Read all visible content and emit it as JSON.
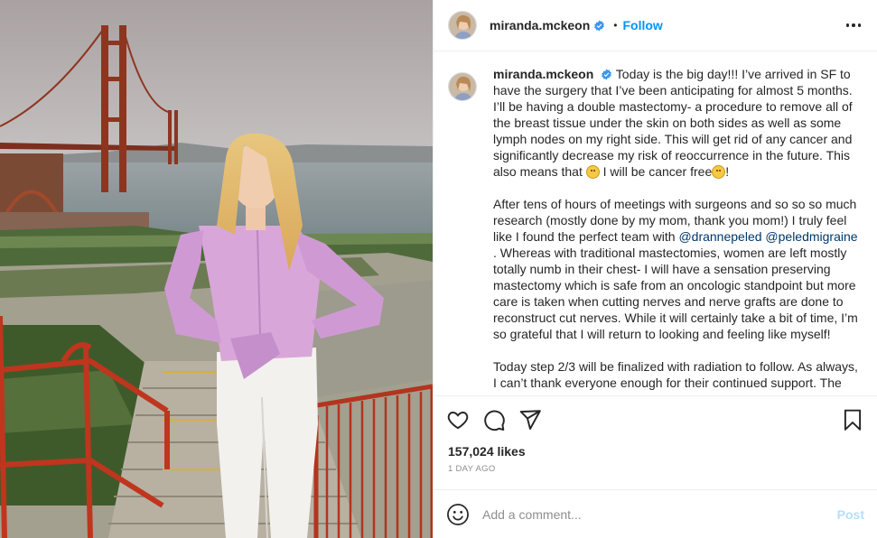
{
  "post": {
    "username": "miranda.mckeon",
    "verified": true,
    "separator": "•",
    "follow_label": "Follow",
    "more_icon": "more-options-icon",
    "image_alt": "Woman in pink shirt and white jeans standing on steps in front of the Golden Gate Bridge"
  },
  "caption": {
    "username": "miranda.mckeon",
    "p1_a": "Today is the big day!!! I’ve arrived in SF to have the surgery that I’ve been anticipating for almost 5 months. I’ll be having a double mastectomy- a procedure to remove all of the breast tissue under the skin on both sides as well as some lymph nodes on my right side. This will get rid of any cancer and significantly decrease my risk of reoccurrence in the future. This also means that",
    "p1_b": "I will be cancer free",
    "p1_c": "!",
    "p2_a": "After tens of hours of meetings with surgeons and so so so much research (mostly done by my mom, thank you mom!) I truly feel like I found the perfect team with",
    "mention1": "@drannepeled",
    "mention2": "@peledmigraine",
    "p2_b": ". Whereas with traditional mastectomies, women are left mostly totally numb in their chest- I will have a sensation preserving mastectomy which is safe from an oncologic standpoint but more care is taken when cutting nerves and nerve grafts are done to reconstruct cut nerves. While it will certainly take a bit of time, I’m so grateful that I will return to looking and feeling like myself!",
    "p3": "Today step 2/3 will be finalized with radiation to follow. As always, I can’t thank everyone enough for their continued support. The",
    "emoji_icon": "smiling-face-with-hearts-icon"
  },
  "actions": {
    "like_icon": "heart-icon",
    "comment_icon": "comment-icon",
    "share_icon": "share-icon",
    "save_icon": "bookmark-icon"
  },
  "likes": "157,024 likes",
  "time": "1 DAY AGO",
  "comment_box": {
    "placeholder": "Add a comment...",
    "value": "",
    "post_label": "Post",
    "emoji_icon": "smiley-icon"
  },
  "colors": {
    "accent": "#0095f6",
    "post_disabled": "#b2dffc",
    "mention": "#00376b",
    "muted": "#8e8e8e",
    "text": "#262626"
  }
}
